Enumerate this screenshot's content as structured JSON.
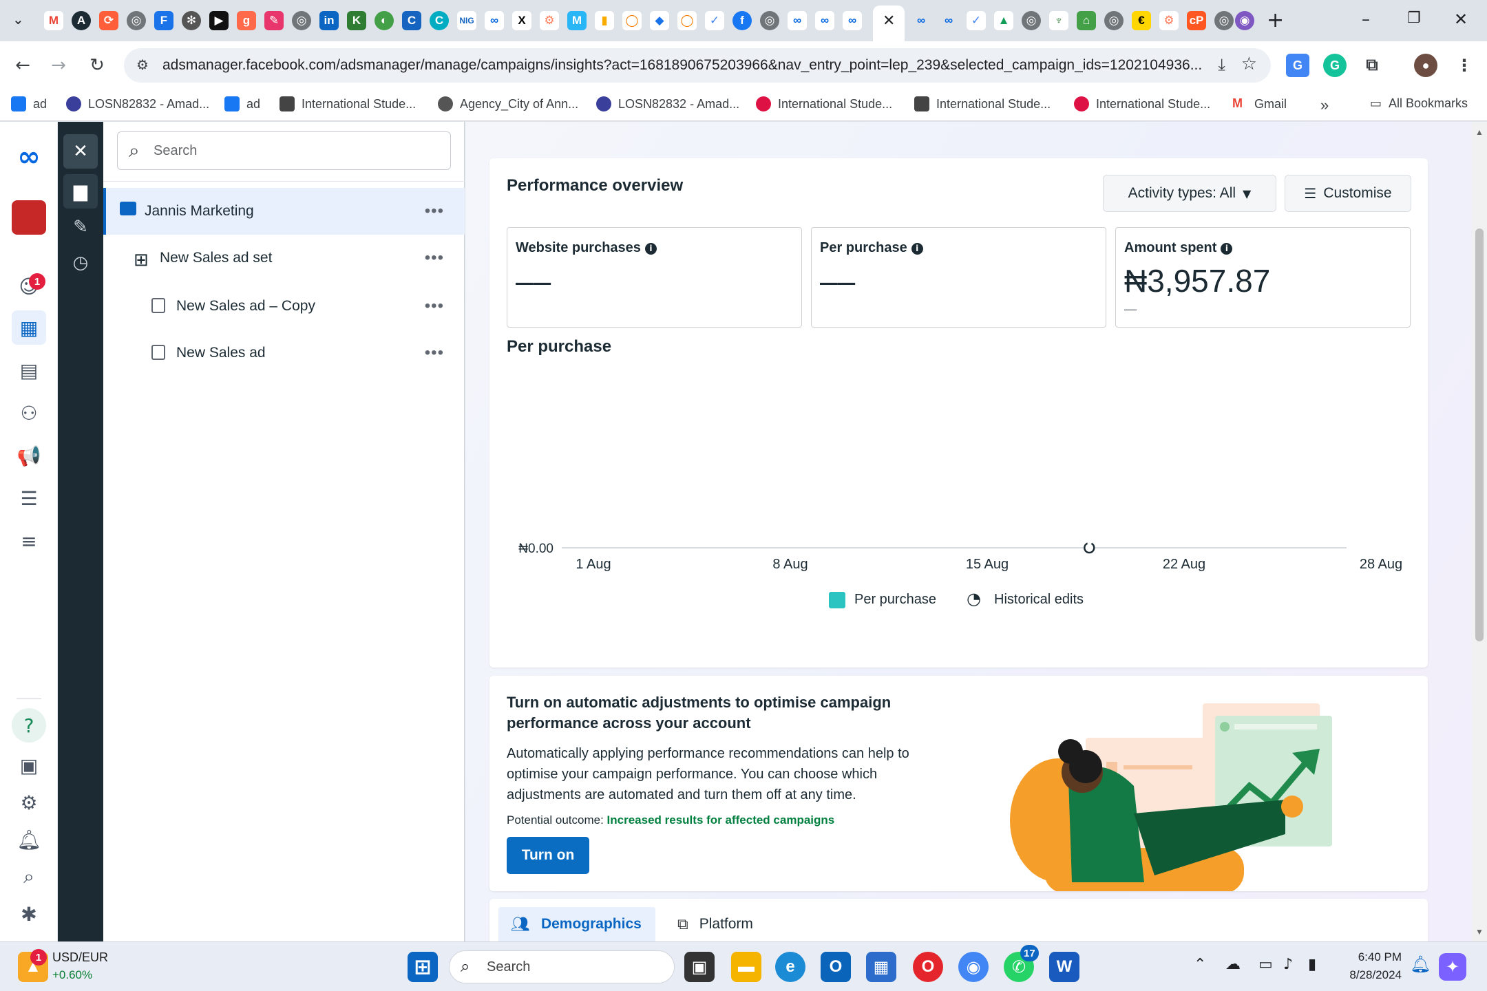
{
  "browser": {
    "url": "adsmanager.facebook.com/adsmanager/manage/campaigns/insights?act=1681890675203966&nav_entry_point=lep_239&selected_campaign_ids=1202104936...",
    "bookmarks": [
      {
        "label": "ad",
        "color": "#1877f2"
      },
      {
        "label": "LOSN82832 - Amad...",
        "color": "#3b3f9c"
      },
      {
        "label": "ad",
        "color": "#1877f2"
      },
      {
        "label": "International Stude...",
        "color": "#444"
      },
      {
        "label": "Agency_City of Ann...",
        "color": "#555"
      },
      {
        "label": "LOSN82832 - Amad...",
        "color": "#3b3f9c"
      },
      {
        "label": "International Stude...",
        "color": "#d14"
      },
      {
        "label": "International Stude...",
        "color": "#444"
      },
      {
        "label": "International Stude...",
        "color": "#d14"
      },
      {
        "label": "Gmail",
        "color": "#ea4335"
      }
    ],
    "more_bookmarks": "»",
    "all_bookmarks": "All Bookmarks"
  },
  "tree": {
    "search_placeholder": "Search",
    "items": [
      {
        "label": "Jannis Marketing",
        "level": "campaign"
      },
      {
        "label": "New Sales ad set",
        "level": "adset"
      },
      {
        "label": "New Sales ad – Copy",
        "level": "ad"
      },
      {
        "label": "New Sales ad",
        "level": "ad"
      }
    ],
    "more": "•••"
  },
  "overview": {
    "title": "Performance overview",
    "activity_button": "Activity types: All",
    "customise_button": "Customise",
    "kpis": [
      {
        "label": "Website purchases",
        "value": "––"
      },
      {
        "label": "Per purchase",
        "value": "––"
      },
      {
        "label": "Amount spent",
        "value": "₦3,957.87",
        "sub": "—"
      }
    ]
  },
  "chart_data": {
    "type": "line",
    "title": "Per purchase",
    "x_ticks": [
      "1 Aug",
      "8 Aug",
      "15 Aug",
      "22 Aug",
      "28 Aug"
    ],
    "y_ticks": [
      "₦0.00"
    ],
    "series": [
      {
        "name": "Per purchase",
        "values": [],
        "color": "#2bc4c0"
      }
    ],
    "annotations": [
      {
        "label": "Historical edits",
        "x": "18 Aug"
      }
    ],
    "legend": [
      "Per purchase",
      "Historical edits"
    ],
    "legend_position": "bottom"
  },
  "promo": {
    "title": "Turn on automatic adjustments to optimise campaign performance across your account",
    "body": "Automatically applying performance recommendations can help to optimise your campaign performance. You can choose which adjustments are automated and turn them off at any time.",
    "outcome_label": "Potential outcome:",
    "outcome_value": "Increased results for affected campaigns",
    "button": "Turn on"
  },
  "tabs": [
    {
      "label": "Demographics",
      "active": true
    },
    {
      "label": "Platform",
      "active": false
    }
  ],
  "rail": {
    "notification_count": "1"
  },
  "taskbar": {
    "ticker_name": "USD/EUR",
    "ticker_change": "+0.60%",
    "ticker_badge": "1",
    "search_placeholder": "Search",
    "whatsapp_badge": "17",
    "time": "6:40 PM",
    "date": "8/28/2024"
  },
  "colors": {
    "accent": "#0a66c2",
    "turn_on": "#0a6dc2",
    "outcome": "#00803f",
    "dark_nav": "#1c2b33"
  }
}
